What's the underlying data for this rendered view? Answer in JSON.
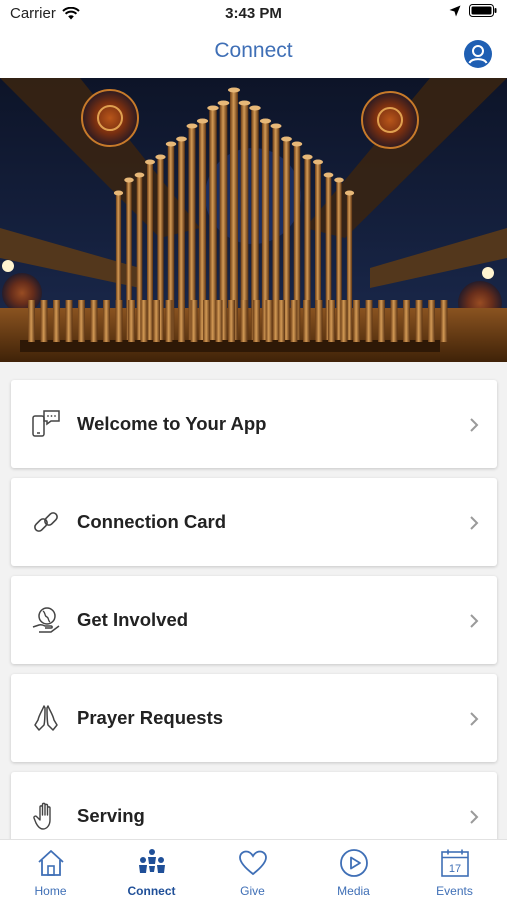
{
  "status_bar": {
    "carrier": "Carrier",
    "time": "3:43 PM"
  },
  "nav": {
    "title": "Connect",
    "profile_icon": "user-circle-icon"
  },
  "hero": {
    "image": "organ-pipes-photo"
  },
  "menu": {
    "items": [
      {
        "label": "Welcome to Your App",
        "icon": "phone-message-icon"
      },
      {
        "label": "Connection Card",
        "icon": "link-icon"
      },
      {
        "label": "Get Involved",
        "icon": "globe-hand-icon"
      },
      {
        "label": "Prayer Requests",
        "icon": "praying-hands-icon"
      },
      {
        "label": "Serving",
        "icon": "hand-icon"
      }
    ]
  },
  "tabs": [
    {
      "label": "Home",
      "icon": "home-icon"
    },
    {
      "label": "Connect",
      "icon": "people-icon",
      "active": true
    },
    {
      "label": "Give",
      "icon": "heart-icon"
    },
    {
      "label": "Media",
      "icon": "play-circle-icon"
    },
    {
      "label": "Events",
      "icon": "calendar-icon",
      "date": "17"
    }
  ],
  "colors": {
    "accent": "#3f6fb6",
    "active": "#1f4f98"
  }
}
